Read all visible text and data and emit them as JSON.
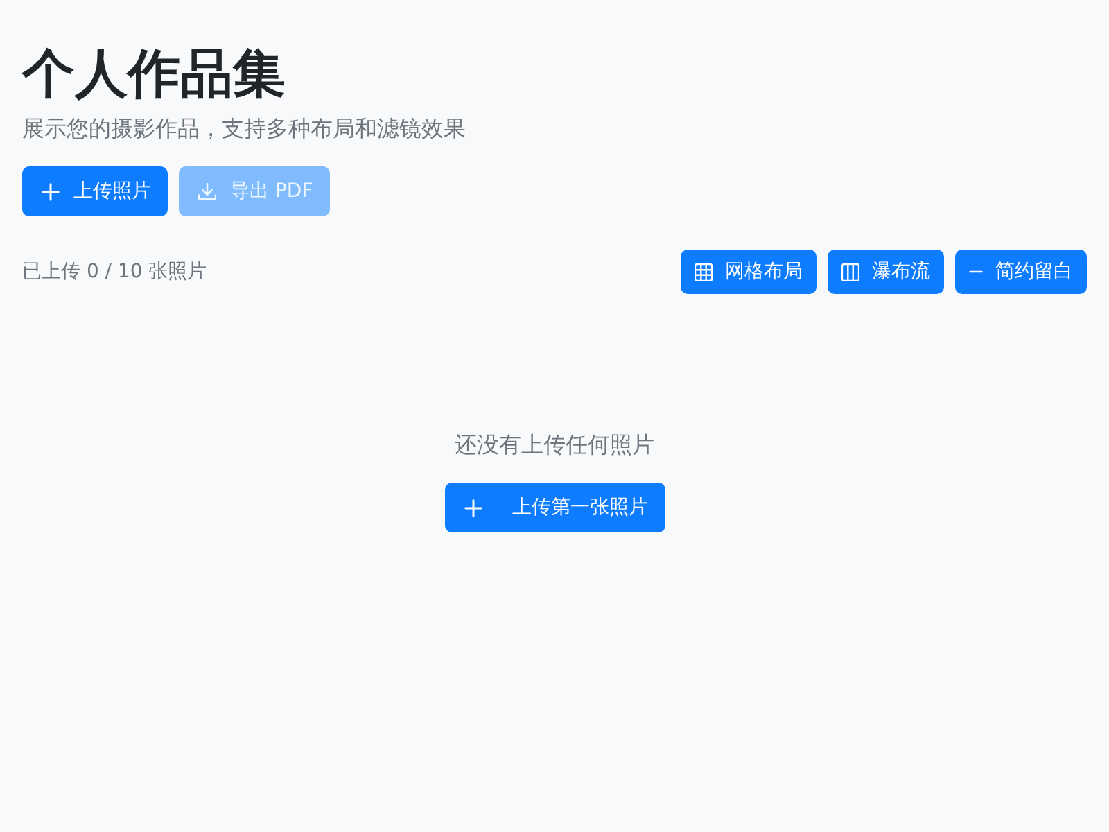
{
  "header": {
    "title": "个人作品集",
    "subtitle": "展示您的摄影作品，支持多种布局和滤镜效果"
  },
  "actions": [
    {
      "kind": "plus",
      "label": "上传照片",
      "disabled": false
    },
    {
      "kind": "download",
      "label": "导出 PDF",
      "disabled": true
    }
  ],
  "toolbar": {
    "count": "已上传 0 / 10 张照片",
    "layouts": [
      {
        "kind": "grid",
        "label": "网格布局"
      },
      {
        "kind": "columns",
        "label": "瀑布流"
      },
      {
        "kind": "minus",
        "label": "简约留白"
      }
    ]
  },
  "empty_state": {
    "message": "还没有上传任何照片",
    "button": {
      "kind": "plus",
      "label": "上传第一张照片"
    }
  }
}
